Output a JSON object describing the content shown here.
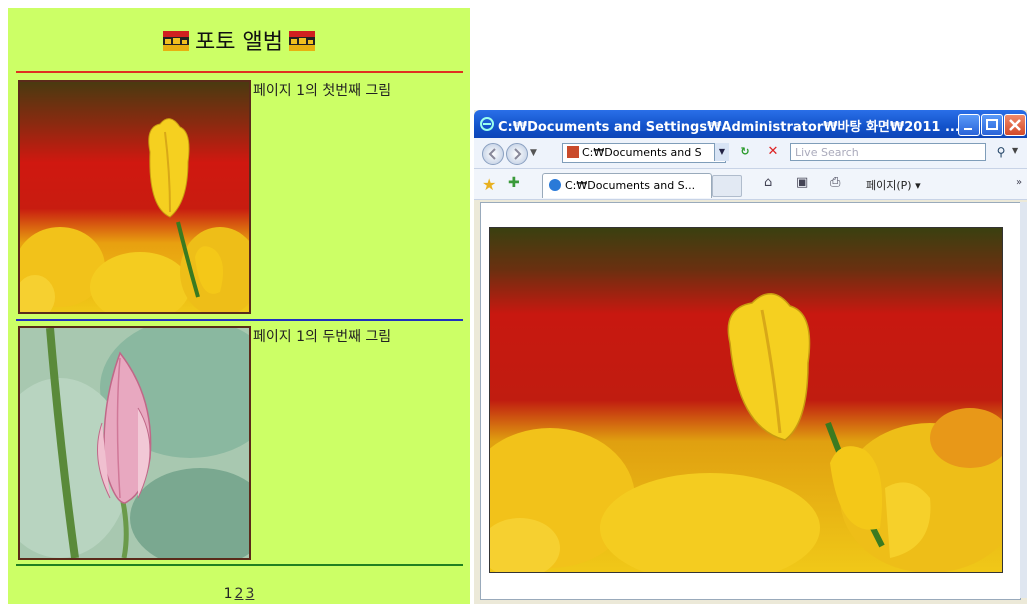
{
  "album": {
    "title": "포토 앨범",
    "photos": [
      {
        "caption": "페이지 1의 첫번째 그림",
        "subject": "yellow tulip"
      },
      {
        "caption": "페이지 1의 두번째 그림",
        "subject": "pink lotus bud"
      }
    ],
    "pagination": [
      "1",
      "2",
      "3"
    ],
    "colors": {
      "background": "#ccff66",
      "divider_top": "#e03020",
      "divider_mid": "#2030c0",
      "divider_bottom": "#208020"
    }
  },
  "browser": {
    "title": "C:₩Documents and Settings₩Administrator₩바탕 화면₩2011 ...",
    "address": "C:₩Documents and S",
    "search_placeholder": "Live Search",
    "tab_label": "C:₩Documents and S...",
    "page_menu": "페이지(P)",
    "icons": [
      "back-icon",
      "forward-icon",
      "refresh-icon",
      "stop-icon",
      "search-icon",
      "favorites-star-icon",
      "add-favorites-icon",
      "home-icon",
      "feed-icon",
      "print-icon"
    ],
    "content_photo": "yellow tulip"
  }
}
